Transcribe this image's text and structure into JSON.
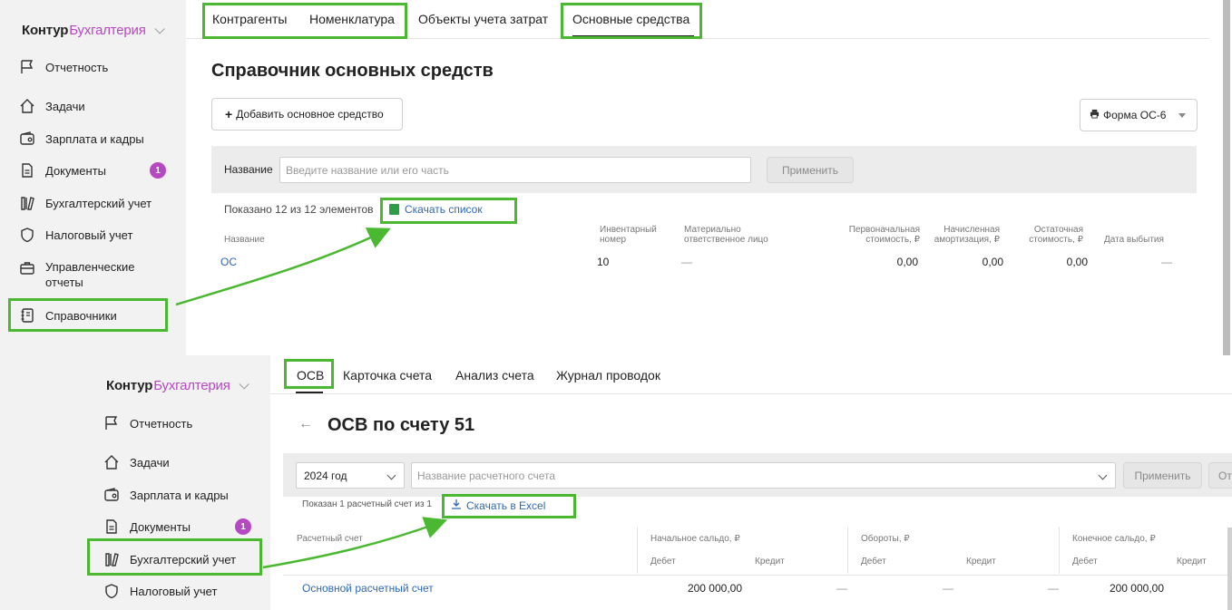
{
  "top": {
    "brand": {
      "part1": "Контур",
      "part2": "Бухгалтерия"
    },
    "nav": [
      {
        "label": "Отчетность",
        "icon": "flag-icon"
      },
      {
        "label": "Задачи",
        "icon": "home-icon"
      },
      {
        "label": "Зарплата и кадры",
        "icon": "wallet-icon"
      },
      {
        "label": "Документы",
        "icon": "document-icon",
        "badge": "1"
      },
      {
        "label": "Бухгалтерский учет",
        "icon": "books-icon"
      },
      {
        "label": "Налоговый учет",
        "icon": "shield-icon"
      },
      {
        "label": "Управленческие отчеты",
        "icon": "briefcase-icon"
      },
      {
        "label": "Справочники",
        "icon": "notebook-icon"
      }
    ],
    "tabs": [
      "Контрагенты",
      "Номенклатура",
      "Объекты учета затрат",
      "Основные средства"
    ],
    "title": "Справочник основных средств",
    "add_button": "Добавить основное средство",
    "form_button": "Форма ОС-6",
    "filter": {
      "label": "Название",
      "placeholder": "Введите название или его часть",
      "apply": "Применить"
    },
    "shown_text": "Показано 12 из 12 элементов",
    "download_link": "Скачать список",
    "columns": {
      "name": "Название",
      "inventory": [
        "Инвентарный",
        "номер"
      ],
      "responsible": [
        "Материально",
        "ответственное лицо"
      ],
      "initial_cost": [
        "Первоначальная",
        "стоимость, ₽"
      ],
      "depreciation": [
        "Начисленная",
        "амортизация, ₽"
      ],
      "residual": [
        "Остаточная",
        "стоимость, ₽"
      ],
      "disposal": "Дата выбытия"
    },
    "row": {
      "name": "ОС",
      "inventory": "10",
      "responsible": "—",
      "initial_cost": "0,00",
      "depreciation": "0,00",
      "residual": "0,00",
      "disposal": "—"
    }
  },
  "bottom": {
    "brand": {
      "part1": "Контур",
      "part2": "Бухгалтерия"
    },
    "nav": [
      {
        "label": "Отчетность",
        "icon": "flag-icon"
      },
      {
        "label": "Задачи",
        "icon": "home-icon"
      },
      {
        "label": "Зарплата и кадры",
        "icon": "wallet-icon"
      },
      {
        "label": "Документы",
        "icon": "document-icon",
        "badge": "1"
      },
      {
        "label": "Бухгалтерский учет",
        "icon": "books-icon"
      },
      {
        "label": "Налоговый учет",
        "icon": "shield-icon"
      }
    ],
    "tabs": [
      "ОСВ",
      "Карточка счета",
      "Анализ счета",
      "Журнал проводок"
    ],
    "back_arrow": "←",
    "title": "ОСВ по счету 51",
    "year_select": "2024 год",
    "account_placeholder": "Название расчетного счета",
    "apply": "Применить",
    "cut_button": "От",
    "shown_text": "Показан 1 расчетный счет из 1",
    "download_link": "Скачать в Excel",
    "columns": {
      "account": "Расчетный счет",
      "opening": "Начальное сальдо, ₽",
      "turnover": "Обороты, ₽",
      "closing": "Конечное сальдо, ₽",
      "debit": "Дебет",
      "credit": "Кредит"
    },
    "row": {
      "account": "Основной расчетный счет",
      "opening_debit": "200 000,00",
      "opening_credit": "—",
      "turnover_debit": "—",
      "turnover_credit": "—",
      "closing_debit": "200 000,00"
    }
  },
  "colors": {
    "accent_green": "#4ab830",
    "brand_purple": "#b748c3",
    "link_blue": "#2f68b8"
  }
}
